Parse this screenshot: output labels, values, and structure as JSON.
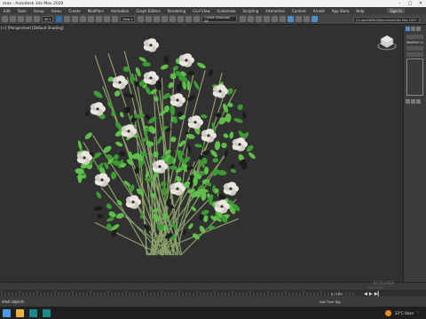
{
  "window": {
    "title": "max - Autodesk 3ds Max 2020"
  },
  "menubar": {
    "items": [
      "Edit",
      "Tools",
      "Group",
      "Views",
      "Create",
      "Modifiers",
      "Animation",
      "Graph Editors",
      "Rendering",
      "Civil View",
      "Customize",
      "Scripting",
      "Interactive",
      "Content",
      "Arnold",
      "App Store",
      "Help"
    ],
    "signin": "Sign In"
  },
  "toolbar": {
    "filter": "All",
    "view": "View",
    "selection_set": "Create Selection Se",
    "path": "C:\\Users\\WIN10\\Documents\\3ds Max 2020"
  },
  "viewport": {
    "label": "[+] [Perspective] [Default Shading]"
  },
  "command_panel": {
    "label": "Modifier List"
  },
  "statusbar": {
    "text": "elect objects",
    "add_tag": "Add Time Tag",
    "frame": "0 / 100",
    "watermark": "Activate",
    "watermark_sub": "Go to Setti"
  },
  "taskbar": {
    "weather": "33°C  Haze"
  },
  "colors": {
    "accent": "#4b8ec9",
    "leaf": "#3e9a34",
    "flower": "#e8e6df"
  }
}
